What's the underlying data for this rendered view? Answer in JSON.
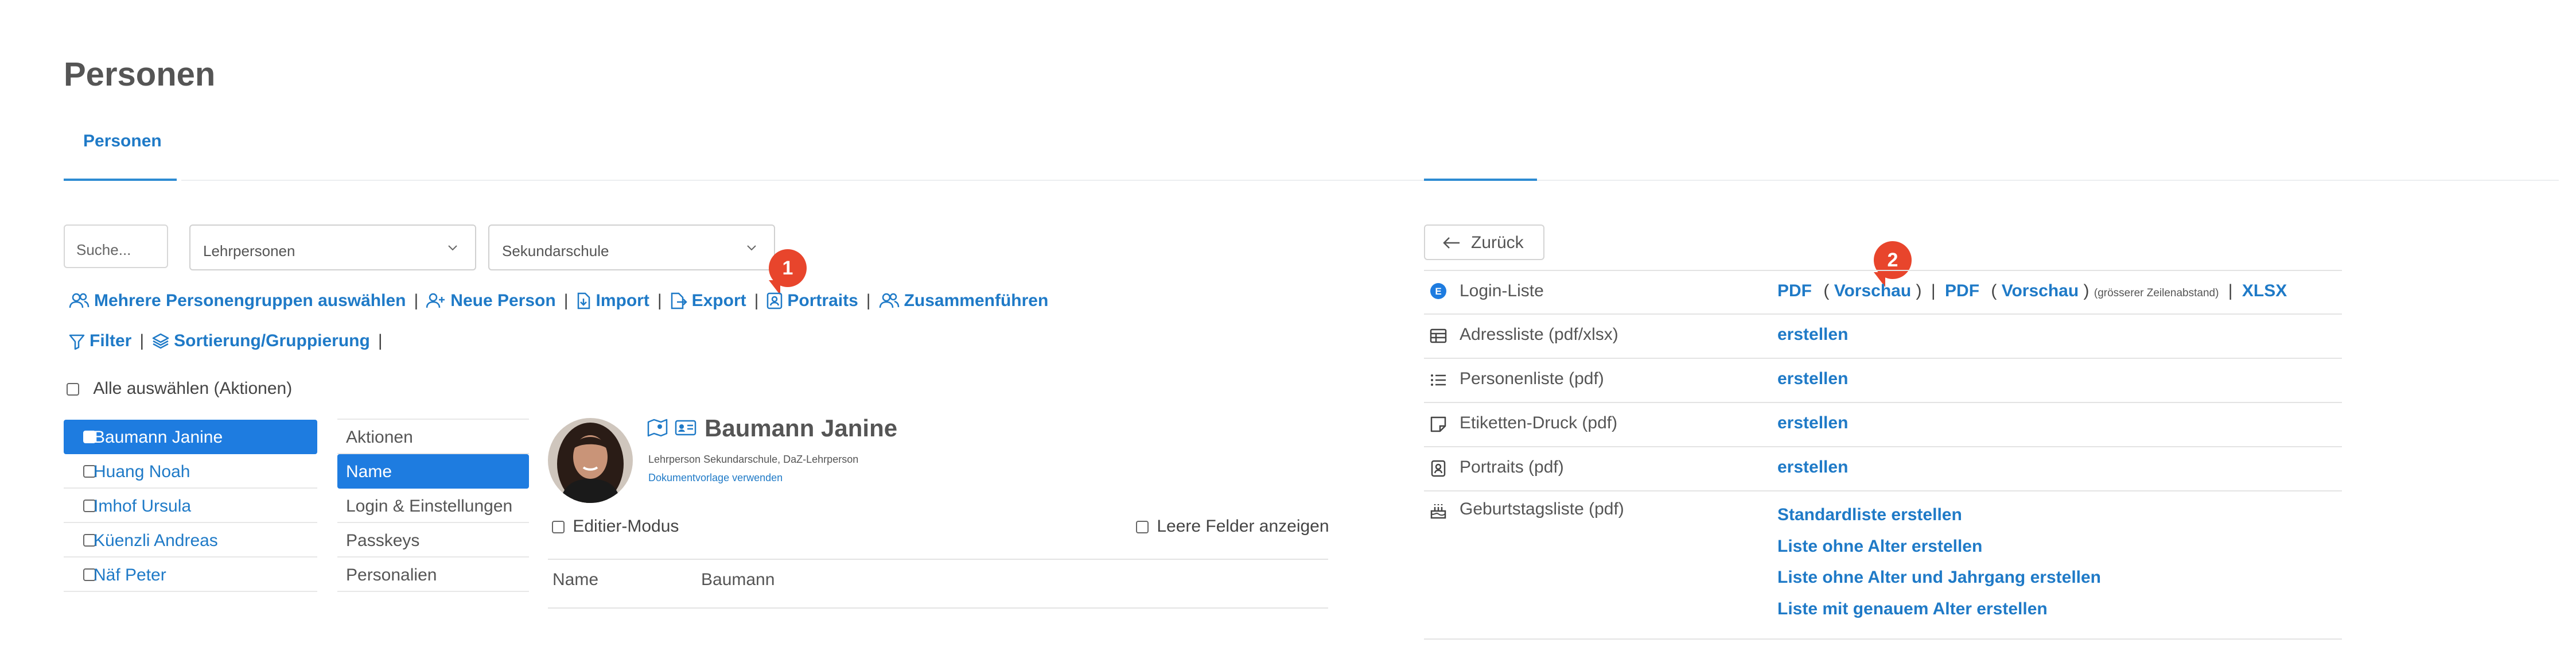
{
  "page": {
    "title": "Personen"
  },
  "tabs": [
    {
      "label": "Personen",
      "active": true
    }
  ],
  "filters": {
    "search_placeholder": "Suche...",
    "group_select": "Lehrpersonen",
    "school_select": "Sekundarschule"
  },
  "toolbar": {
    "multi_groups": "Mehrere Personengruppen auswählen",
    "new_person": "Neue Person",
    "import": "Import",
    "export": "Export",
    "portraits": "Portraits",
    "merge": "Zusammenführen",
    "filter": "Filter",
    "sort_group": "Sortierung/Gruppierung",
    "separator": "|"
  },
  "select_all_label": "Alle auswählen (Aktionen)",
  "persons": [
    {
      "name": "Baumann Janine",
      "selected": true
    },
    {
      "name": "Huang Noah",
      "selected": false
    },
    {
      "name": "Imhof Ursula",
      "selected": false
    },
    {
      "name": "Küenzli Andreas",
      "selected": false
    },
    {
      "name": "Näf Peter",
      "selected": false
    }
  ],
  "subnav": [
    {
      "label": "Aktionen",
      "selected": false
    },
    {
      "label": "Name",
      "selected": true
    },
    {
      "label": "Login & Einstellungen",
      "selected": false
    },
    {
      "label": "Passkeys",
      "selected": false
    },
    {
      "label": "Personalien",
      "selected": false
    }
  ],
  "detail": {
    "name": "Baumann Janine",
    "subtitle": "Lehrperson Sekundarschule, DaZ-Lehrperson",
    "doc_link": "Dokumentvorlage verwenden",
    "edit_mode": "Editier-Modus",
    "empty_fields": "Leere Felder anzeigen",
    "field_label": "Name",
    "field_value": "Baumann"
  },
  "callouts": [
    "1",
    "2"
  ],
  "export_panel": {
    "back": "Zurück",
    "rows": [
      {
        "icon": "e-badge-icon",
        "label": "Login-Liste",
        "pdf": "PDF",
        "open": "(",
        "preview": "Vorschau",
        "close": ")",
        "bar": "|",
        "pdf2": "PDF",
        "open2": "(",
        "preview2": "Vorschau",
        "close2": ")",
        "note": "(grösserer Zeilenabstand)",
        "bar2": "|",
        "xlsx": "XLSX"
      },
      {
        "icon": "table-icon",
        "label": "Adressliste (pdf/xlsx)",
        "action": "erstellen"
      },
      {
        "icon": "list-icon",
        "label": "Personenliste (pdf)",
        "action": "erstellen"
      },
      {
        "icon": "sticky-note-icon",
        "label": "Etiketten-Druck (pdf)",
        "action": "erstellen"
      },
      {
        "icon": "portrait-icon",
        "label": "Portraits (pdf)",
        "action": "erstellen"
      },
      {
        "icon": "cake-icon",
        "label": "Geburtstagsliste (pdf)",
        "actions": [
          "Standardliste erstellen",
          "Liste ohne Alter erstellen",
          "Liste ohne Alter und Jahrgang erstellen",
          "Liste mit genauem Alter erstellen"
        ]
      }
    ]
  },
  "colors": {
    "accent": "#1f7ac7",
    "selected": "#1e7ce0",
    "badge": "#e8452c"
  }
}
